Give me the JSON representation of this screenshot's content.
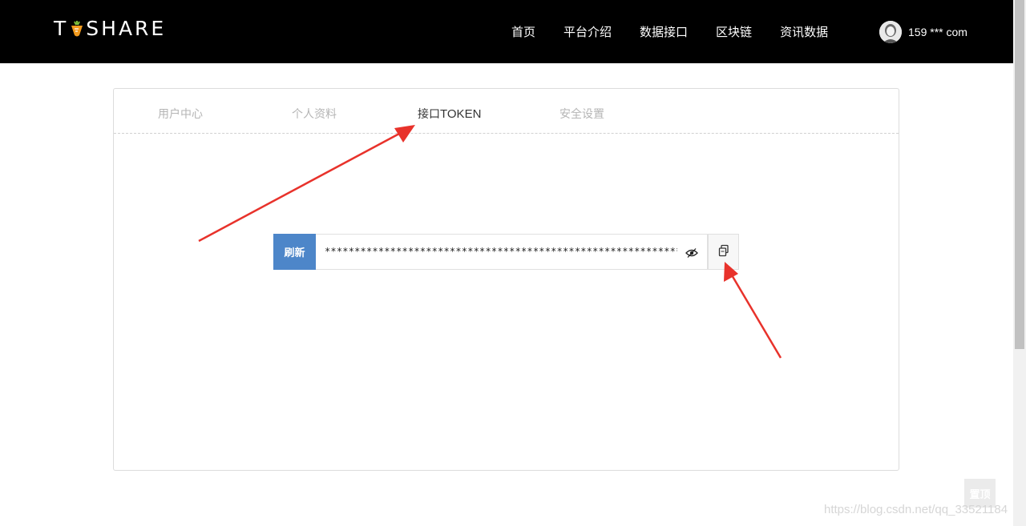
{
  "header": {
    "logo_text_left": "T",
    "logo_text_right": "SHARE",
    "nav": [
      "首页",
      "平台介绍",
      "数据接口",
      "区块链",
      "资讯数据"
    ],
    "user_label": "159 *** com"
  },
  "tabs": {
    "user_center": "用户中心",
    "profile": "个人资料",
    "api_token_cjk": "接口",
    "api_token_latin": "TOKEN",
    "security": "安全设置"
  },
  "token": {
    "refresh_label": "刷新",
    "masked_value": "*****************************************************************"
  },
  "footer": {
    "to_top_label": "置顶",
    "watermark": "https://blog.csdn.net/qq_33521184"
  },
  "colors": {
    "accent": "#4d86c9",
    "annotation_arrow": "#e8322b"
  }
}
